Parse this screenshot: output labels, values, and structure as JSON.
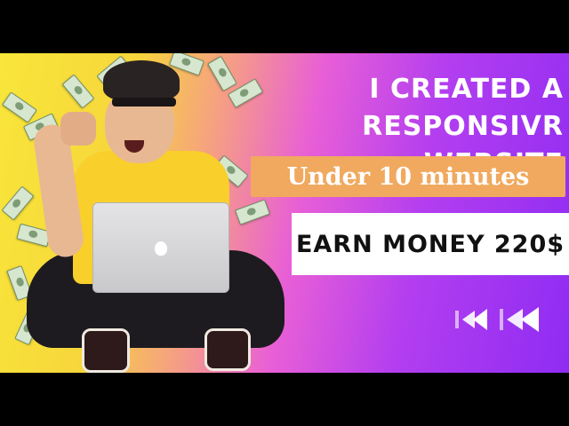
{
  "headline": {
    "line1": "I CREATED A",
    "line2": "RESPONSIVR WEBSITE"
  },
  "subheadline": "Under 10 minutes",
  "earn_label": "EARN MONEY 220$",
  "icons": {
    "arrows": "double-rewind-arrows-icon",
    "laptop_logo": "apple-logo-icon",
    "money": "dollar-bill-icon"
  },
  "colors": {
    "gradient_start": "#f8e63a",
    "gradient_mid": "#e85fd6",
    "gradient_end": "#8f2cf2",
    "pill": "#f1a95f",
    "shirt": "#f9cf2b"
  }
}
